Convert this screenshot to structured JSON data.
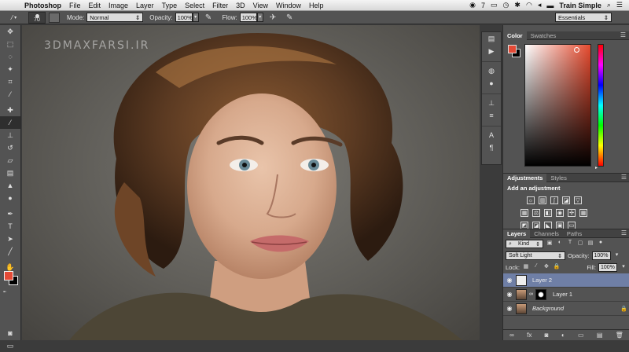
{
  "menubar": {
    "apple_icon": "apple-logo-icon",
    "app_name": "Photoshop",
    "items": [
      "File",
      "Edit",
      "Image",
      "Layer",
      "Type",
      "Select",
      "Filter",
      "3D",
      "View",
      "Window",
      "Help"
    ],
    "status": {
      "notification_count": "7",
      "user_name": "Train Simple"
    }
  },
  "options": {
    "brush_size": "70",
    "mode_label": "Mode:",
    "mode_value": "Normal",
    "opacity_label": "Opacity:",
    "opacity_value": "100%",
    "flow_label": "Flow:",
    "flow_value": "100%",
    "workspace_value": "Essentials"
  },
  "canvas": {
    "watermark": "3DMAXFARSI.IR"
  },
  "color_panel": {
    "tabs": [
      "Color",
      "Swatches"
    ],
    "foreground_color": "#e44a36",
    "background_color": "#000000"
  },
  "adjustments_panel": {
    "tabs": [
      "Adjustments",
      "Styles"
    ],
    "title": "Add an adjustment"
  },
  "layers_panel": {
    "tabs": [
      "Layers",
      "Channels",
      "Paths"
    ],
    "filter_value": "Kind",
    "blend_mode": "Soft Light",
    "opacity_label": "Opacity:",
    "opacity_value": "100%",
    "lock_label": "Lock:",
    "fill_label": "Fill:",
    "fill_value": "100%",
    "layers": [
      {
        "name": "Layer 2",
        "selected": true
      },
      {
        "name": "Layer 1",
        "selected": false
      },
      {
        "name": "Background",
        "selected": false
      }
    ]
  },
  "colors": {
    "accent": "#e44a36",
    "panel_bg": "#535353",
    "selection": "#6f7fa6"
  }
}
